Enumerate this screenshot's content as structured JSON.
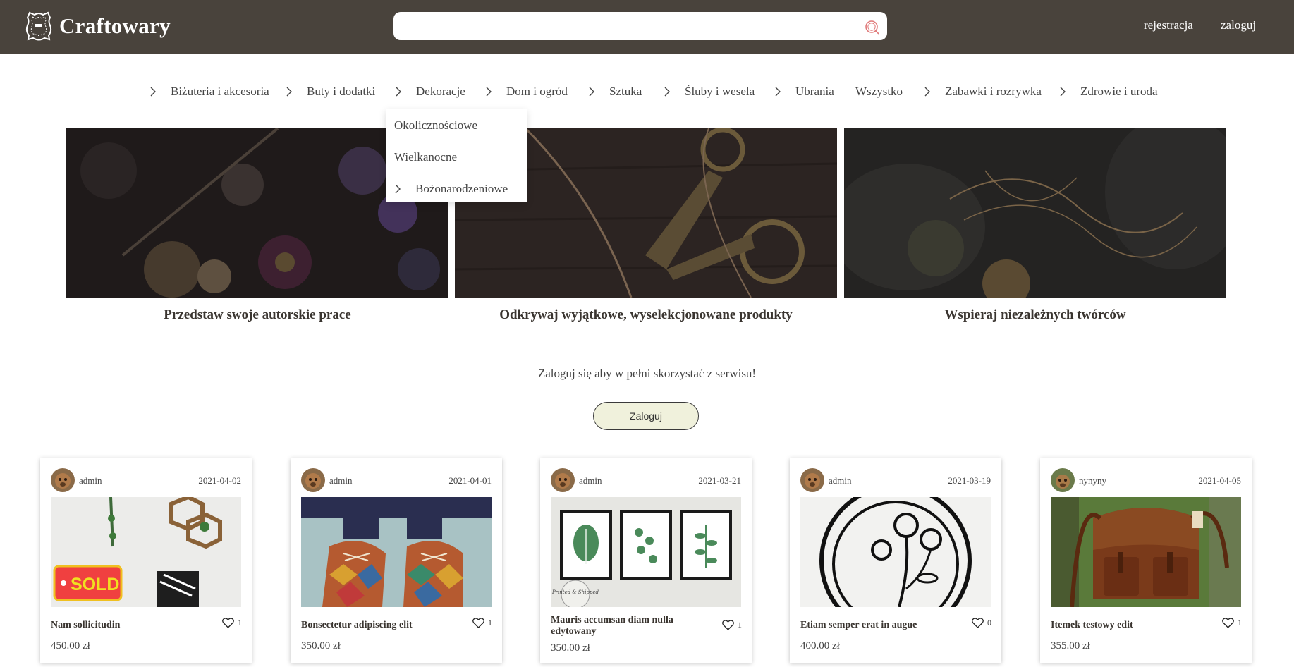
{
  "header": {
    "logo_text": "Craftowary",
    "search_placeholder": "",
    "register_label": "rejestracja",
    "login_label": "zaloguj"
  },
  "nav": {
    "items": [
      {
        "label": "Biżuteria i akcesoria",
        "has_submenu": true
      },
      {
        "label": "Buty i dodatki",
        "has_submenu": true
      },
      {
        "label": "Dekoracje",
        "has_submenu": true
      },
      {
        "label": "Dom i ogród",
        "has_submenu": true
      },
      {
        "label": "Sztuka",
        "has_submenu": true
      },
      {
        "label": "Śluby i wesela",
        "has_submenu": true
      },
      {
        "label": "Ubrania",
        "has_submenu": true
      },
      {
        "label": "Wszystko",
        "has_submenu": false
      },
      {
        "label": "Zabawki i rozrywka",
        "has_submenu": true
      },
      {
        "label": "Zdrowie i uroda",
        "has_submenu": true
      }
    ]
  },
  "dropdown": {
    "items": [
      {
        "label": "Okolicznościowe",
        "has_submenu": false
      },
      {
        "label": "Wielkanocne",
        "has_submenu": false
      },
      {
        "label": "Bożonarodzeniowe",
        "has_submenu": true
      }
    ]
  },
  "hero": {
    "captions": [
      "Przedstaw swoje autorskie prace",
      "Odkrywaj wyjątkowe, wyselekcjonowane produkty",
      "Wspieraj niezależnych twórców"
    ]
  },
  "cta": {
    "text": "Zaloguj się aby w pełni skorzystać z serwisu!",
    "button_label": "Zaloguj"
  },
  "products": [
    {
      "author": "admin",
      "date": "2021-04-02",
      "title": "Nam sollicitudin",
      "likes": "1",
      "price": "450.00 zł",
      "badge": "SOLD"
    },
    {
      "author": "admin",
      "date": "2021-04-01",
      "title": "Bonsectetur adipiscing elit",
      "likes": "1",
      "price": "350.00 zł"
    },
    {
      "author": "admin",
      "date": "2021-03-21",
      "title": "Mauris accumsan diam nulla edytowany",
      "likes": "1",
      "price": "350.00 zł",
      "stamp": "Printed & Shipped"
    },
    {
      "author": "admin",
      "date": "2021-03-19",
      "title": "Etiam semper erat in augue",
      "likes": "0",
      "price": "400.00 zł"
    },
    {
      "author": "nynyny",
      "date": "2021-04-05",
      "title": "Itemek testowy edit",
      "likes": "1",
      "price": "355.00 zł"
    }
  ],
  "colors": {
    "header_bg": "#49433c",
    "button_bg": "#f0f1dc",
    "search_icon": "#e07a7a"
  },
  "icons": {
    "logo": "leather-hide-icon",
    "search": "search-icon",
    "nav_arrow": "chevron-right-icon",
    "like": "heart-icon"
  }
}
